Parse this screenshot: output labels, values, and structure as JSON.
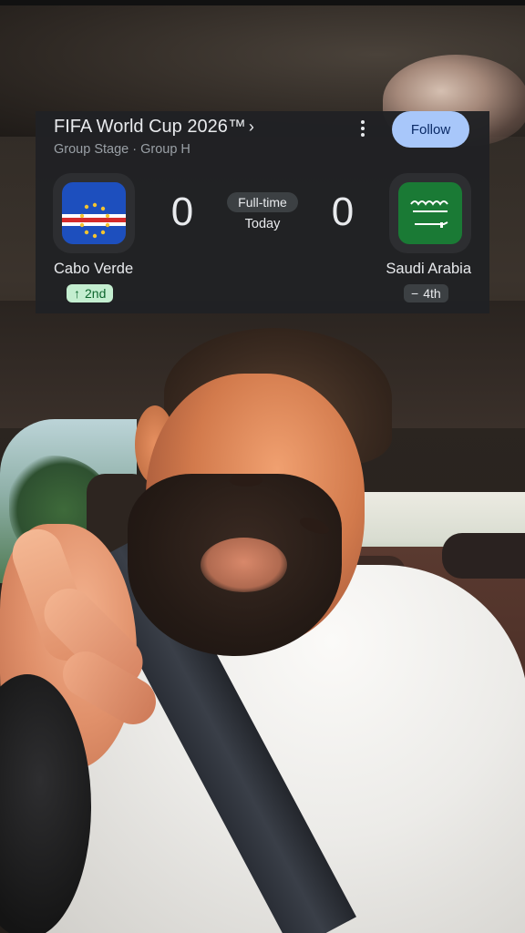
{
  "card": {
    "title": "FIFA World Cup 2026™",
    "title_chevron": "›",
    "subtitle": "Group Stage · Group H",
    "follow_label": "Follow",
    "status": "Full-time",
    "day": "Today",
    "home": {
      "name": "Cabo Verde",
      "score": "0",
      "rank": "2nd",
      "rank_arrow": "↑",
      "flag": "cabo-verde-flag"
    },
    "away": {
      "name": "Saudi Arabia",
      "score": "0",
      "rank": "4th",
      "rank_arrow": "−",
      "flag": "saudi-arabia-flag"
    }
  },
  "colors": {
    "card_bg": "#202124",
    "follow_bg": "#a8c7fa",
    "rank_up_bg": "#c4eed0",
    "rank_up_fg": "#0d652d",
    "cv_blue": "#1d4fbe",
    "cv_red": "#d42a2a",
    "cv_star": "#f4c430",
    "sa_green": "#1a7a35"
  }
}
